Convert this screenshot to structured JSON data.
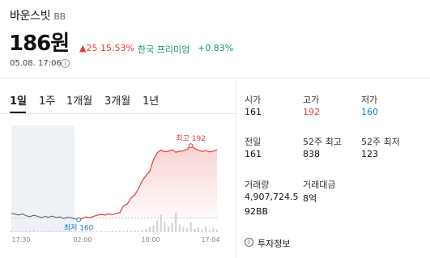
{
  "header": {
    "coin_name": "바운스빗",
    "ticker": "BB",
    "price": "186원",
    "change": "▲25 15.53%",
    "premium_label": "한국 프리미엄",
    "premium_value": "+0.83%",
    "timestamp": "05.08. 17:06",
    "info_icon_glyph": "i"
  },
  "tabs": [
    {
      "label": "1일",
      "active": true
    },
    {
      "label": "1주",
      "active": false
    },
    {
      "label": "1개월",
      "active": false
    },
    {
      "label": "3개월",
      "active": false
    },
    {
      "label": "1년",
      "active": false
    }
  ],
  "chart_data": {
    "type": "line",
    "x_ticks": [
      "17:30",
      "02:00",
      "10:00",
      "17:04"
    ],
    "max_label": "최고 192",
    "min_label": "최저 160",
    "max": 192,
    "min": 160,
    "ylim": [
      155,
      200
    ],
    "baseline": 161,
    "series": [
      {
        "values": [
          163,
          162.7,
          162.3,
          162.8,
          162,
          161.6,
          162.2,
          161.8,
          161.2,
          161.7,
          161.4,
          161.9,
          161.2,
          161.5,
          160.8,
          161.3,
          161.1,
          160.7,
          160.3,
          160.9,
          161.5,
          161.2,
          161.8,
          162.2,
          162.6,
          162.3,
          162.8,
          162.5,
          163,
          163.3,
          166.2,
          167,
          169.6,
          171,
          173.6,
          177,
          179.2,
          181,
          186,
          189,
          190.1,
          189.4,
          189.6,
          190.2,
          189.2,
          189.6,
          189.8,
          190.4,
          192,
          190.8,
          190.1,
          189.5,
          189.9,
          189.3,
          189.7,
          190.2
        ]
      }
    ],
    "volume": [
      0.08,
      0.05,
      0.06,
      0.04,
      0.07,
      0.05,
      0.09,
      0.06,
      0.04,
      0.05,
      0.07,
      0.05,
      0.06,
      0.04,
      0.05,
      0.06,
      0.08,
      0.05,
      0.04,
      0.06,
      0.05,
      0.07,
      0.04,
      0.05,
      0.06,
      0.05,
      0.04,
      0.06,
      0.05,
      0.07,
      0.06,
      0.08,
      0.07,
      0.1,
      0.09,
      0.12,
      0.15,
      0.25,
      0.35,
      0.6,
      0.9,
      0.55,
      0.3,
      0.45,
      1.0,
      0.4,
      0.28,
      0.22,
      0.5,
      0.18,
      0.24,
      0.15,
      0.3,
      0.12,
      0.2,
      0.14
    ]
  },
  "stats": {
    "open_label": "시가",
    "open_value": "161",
    "high_label": "고가",
    "high_value": "192",
    "low_label": "저가",
    "low_value": "160",
    "prev_label": "전일",
    "prev_value": "161",
    "w52_high_label": "52주 최고",
    "w52_high_value": "838",
    "w52_low_label": "52주 최저",
    "w52_low_value": "123",
    "volume_label": "거래량",
    "volume_value": "4,907,724.5",
    "volume_unit": "92BB",
    "amount_label": "거래대금",
    "amount_value": "8억"
  },
  "invest_info": {
    "label": "투자정보",
    "icon_glyph": "i"
  },
  "colors": {
    "up": "#e53935",
    "down_blue": "#1976d2",
    "premium_green": "#16946b",
    "line_gray": "#555555",
    "line_red": "#e53935"
  }
}
